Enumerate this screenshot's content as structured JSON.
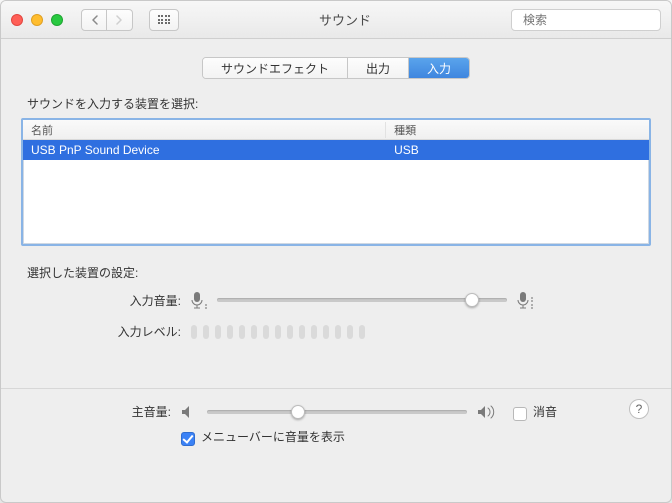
{
  "window": {
    "title": "サウンド"
  },
  "search": {
    "placeholder": "検索"
  },
  "tabs": [
    {
      "id": "effects",
      "label": "サウンドエフェクト",
      "active": false
    },
    {
      "id": "output",
      "label": "出力",
      "active": false
    },
    {
      "id": "input",
      "label": "入力",
      "active": true
    }
  ],
  "sections": {
    "device_select_label": "サウンドを入力する装置を選択:",
    "device_settings_label": "選択した装置の設定:"
  },
  "table": {
    "cols": {
      "name": "名前",
      "kind": "種類"
    },
    "rows": [
      {
        "name": "USB PnP Sound Device",
        "kind": "USB",
        "selected": true
      }
    ]
  },
  "controls": {
    "input_volume_label": "入力音量:",
    "input_volume_pct": 88,
    "input_level_label": "入力レベル:",
    "main_volume_label": "主音量:",
    "main_volume_pct": 35,
    "mute_label": "消音",
    "mute_checked": false,
    "menubar_label": "メニューバーに音量を表示",
    "menubar_checked": true
  },
  "icons": {
    "mic": "mic-icon",
    "speaker_low": "speaker-low-icon",
    "speaker_high": "speaker-high-icon"
  }
}
